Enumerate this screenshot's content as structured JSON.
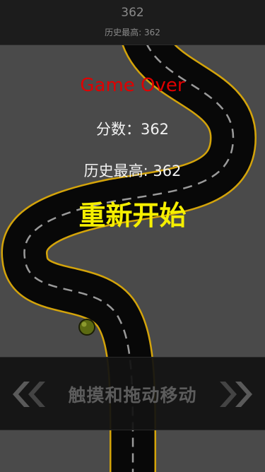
{
  "topbar": {
    "score": "362",
    "best": "历史最高: 362"
  },
  "game_over": {
    "title": "Game Over",
    "score_line": "分数：362",
    "best_line": "历史最高: 362",
    "restart_label": "重新开始"
  },
  "controls": {
    "hint": "触摸和拖动移动"
  },
  "icons": {
    "left": "double-chevron-left-icon",
    "right": "double-chevron-right-icon",
    "ball": "ball-icon"
  },
  "colors": {
    "background": "#4a4a4a",
    "road": "#080808",
    "road_edge": "#d4a40a",
    "game_over": "#e00000",
    "restart": "#f5ef00"
  }
}
